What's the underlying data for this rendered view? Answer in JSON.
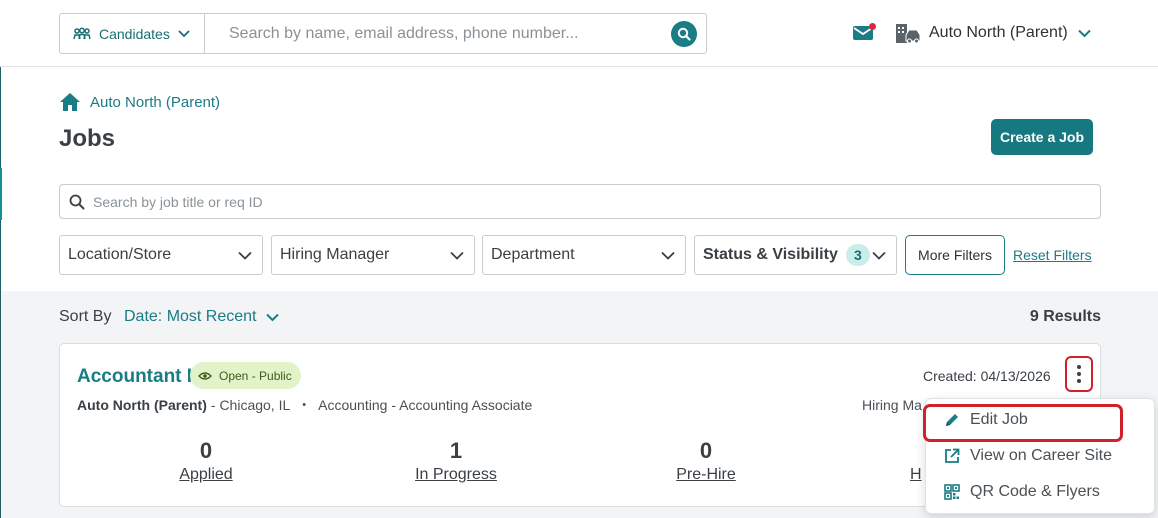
{
  "topbar": {
    "search_scope": "Candidates",
    "search_placeholder": "Search by name, email address, phone number...",
    "org_name": "Auto North (Parent)"
  },
  "breadcrumb": {
    "label": "Auto North (Parent)"
  },
  "page": {
    "title": "Jobs",
    "create_button": "Create a Job"
  },
  "job_search": {
    "placeholder": "Search by job title or req ID"
  },
  "filters": {
    "location": "Location/Store",
    "hiring_manager": "Hiring Manager",
    "department": "Department",
    "status_visibility": "Status & Visibility",
    "status_count": "3",
    "more_filters": "More Filters",
    "reset_filters": "Reset Filters"
  },
  "results": {
    "sort_label": "Sort By",
    "sort_value": "Date: Most Recent",
    "count_text": "9 Results"
  },
  "job": {
    "title": "Accountant I",
    "status": "Open - Public",
    "org": "Auto North (Parent)",
    "location": "- Chicago, IL",
    "dot": "•",
    "department": "Accounting",
    "role": "- Accounting Associate",
    "created": "Created: 04/13/2026",
    "hiring_manager_partial": "Hiring Ma",
    "stats": [
      {
        "num": "0",
        "label": "Applied"
      },
      {
        "num": "1",
        "label": "In Progress"
      },
      {
        "num": "0",
        "label": "Pre-Hire"
      },
      {
        "num": "",
        "label": "H"
      }
    ]
  },
  "menu": {
    "items": [
      {
        "label": "Edit Job",
        "icon": "pencil-icon"
      },
      {
        "label": "View on Career Site",
        "icon": "external-link-icon"
      },
      {
        "label": "QR Code & Flyers",
        "icon": "qr-code-icon"
      }
    ]
  },
  "colors": {
    "brand": "#1a7c84",
    "alert": "#d0202c",
    "status_bg": "#e2f3c9"
  }
}
